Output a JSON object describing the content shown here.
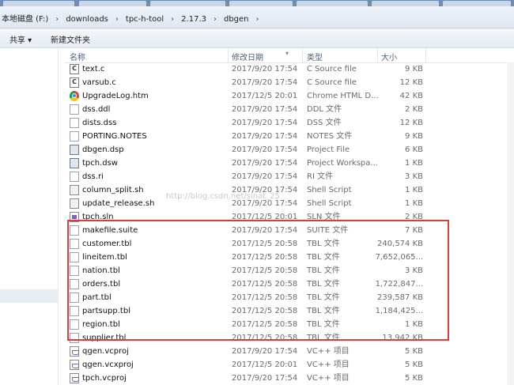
{
  "address_bar": {
    "crumbs": [
      "本地磁盘 (F:)",
      "downloads",
      "tpc-h-tool",
      "2.17.3",
      "dbgen"
    ],
    "separator": "›"
  },
  "toolbar": {
    "share_label": "共享 ▾",
    "new_folder_label": "新建文件夹"
  },
  "columns": {
    "name": "名称",
    "date": "修改日期",
    "type": "类型",
    "size": "大小"
  },
  "watermark": "http://blog.csdn.net/sinat_25",
  "files": [
    {
      "name": "text.c",
      "date": "2017/9/20 17:54",
      "type": "C Source file",
      "size": "9 KB",
      "icon": "c-source-icon"
    },
    {
      "name": "varsub.c",
      "date": "2017/9/20 17:54",
      "type": "C Source file",
      "size": "12 KB",
      "icon": "c-source-icon"
    },
    {
      "name": "UpgradeLog.htm",
      "date": "2017/12/5 20:01",
      "type": "Chrome HTML D...",
      "size": "42 KB",
      "icon": "chrome-html-icon"
    },
    {
      "name": "dss.ddl",
      "date": "2017/9/20 17:54",
      "type": "DDL 文件",
      "size": "2 KB",
      "icon": "file-icon"
    },
    {
      "name": "dists.dss",
      "date": "2017/9/20 17:54",
      "type": "DSS 文件",
      "size": "12 KB",
      "icon": "file-icon"
    },
    {
      "name": "PORTING.NOTES",
      "date": "2017/9/20 17:54",
      "type": "NOTES 文件",
      "size": "9 KB",
      "icon": "file-icon"
    },
    {
      "name": "dbgen.dsp",
      "date": "2017/9/20 17:54",
      "type": "Project File",
      "size": "6 KB",
      "icon": "project-file-icon"
    },
    {
      "name": "tpch.dsw",
      "date": "2017/9/20 17:54",
      "type": "Project Workspa...",
      "size": "1 KB",
      "icon": "project-workspace-icon"
    },
    {
      "name": "dss.ri",
      "date": "2017/9/20 17:54",
      "type": "RI 文件",
      "size": "3 KB",
      "icon": "file-icon"
    },
    {
      "name": "column_split.sh",
      "date": "2017/9/20 17:54",
      "type": "Shell Script",
      "size": "1 KB",
      "icon": "shell-script-icon"
    },
    {
      "name": "update_release.sh",
      "date": "2017/9/20 17:54",
      "type": "Shell Script",
      "size": "1 KB",
      "icon": "shell-script-icon"
    },
    {
      "name": "tpch.sln",
      "date": "2017/12/5 20:01",
      "type": "SLN 文件",
      "size": "2 KB",
      "icon": "solution-file-icon"
    },
    {
      "name": "makefile.suite",
      "date": "2017/9/20 17:54",
      "type": "SUITE 文件",
      "size": "7 KB",
      "icon": "file-icon"
    },
    {
      "name": "customer.tbl",
      "date": "2017/12/5 20:58",
      "type": "TBL 文件",
      "size": "240,574 KB",
      "icon": "file-icon"
    },
    {
      "name": "lineitem.tbl",
      "date": "2017/12/5 20:58",
      "type": "TBL 文件",
      "size": "7,652,065...",
      "icon": "file-icon"
    },
    {
      "name": "nation.tbl",
      "date": "2017/12/5 20:58",
      "type": "TBL 文件",
      "size": "3 KB",
      "icon": "file-icon"
    },
    {
      "name": "orders.tbl",
      "date": "2017/12/5 20:58",
      "type": "TBL 文件",
      "size": "1,722,847...",
      "icon": "file-icon"
    },
    {
      "name": "part.tbl",
      "date": "2017/12/5 20:58",
      "type": "TBL 文件",
      "size": "239,587 KB",
      "icon": "file-icon"
    },
    {
      "name": "partsupp.tbl",
      "date": "2017/12/5 20:58",
      "type": "TBL 文件",
      "size": "1,184,425...",
      "icon": "file-icon"
    },
    {
      "name": "region.tbl",
      "date": "2017/12/5 20:58",
      "type": "TBL 文件",
      "size": "1 KB",
      "icon": "file-icon"
    },
    {
      "name": "supplier.tbl",
      "date": "2017/12/5 20:58",
      "type": "TBL 文件",
      "size": "13,942 KB",
      "icon": "file-icon"
    },
    {
      "name": "qgen.vcproj",
      "date": "2017/9/20 17:54",
      "type": "VC++ 项目",
      "size": "5 KB",
      "icon": "vcproj-icon"
    },
    {
      "name": "qgen.vcxproj",
      "date": "2017/12/5 20:01",
      "type": "VC++ 项目",
      "size": "5 KB",
      "icon": "vcproj-icon"
    },
    {
      "name": "tpch.vcproj",
      "date": "2017/9/20 17:54",
      "type": "VC++ 项目",
      "size": "5 KB",
      "icon": "vcproj-icon"
    }
  ],
  "colors": {
    "highlight_border": "#e03b3b",
    "header_text": "#4c607a"
  }
}
